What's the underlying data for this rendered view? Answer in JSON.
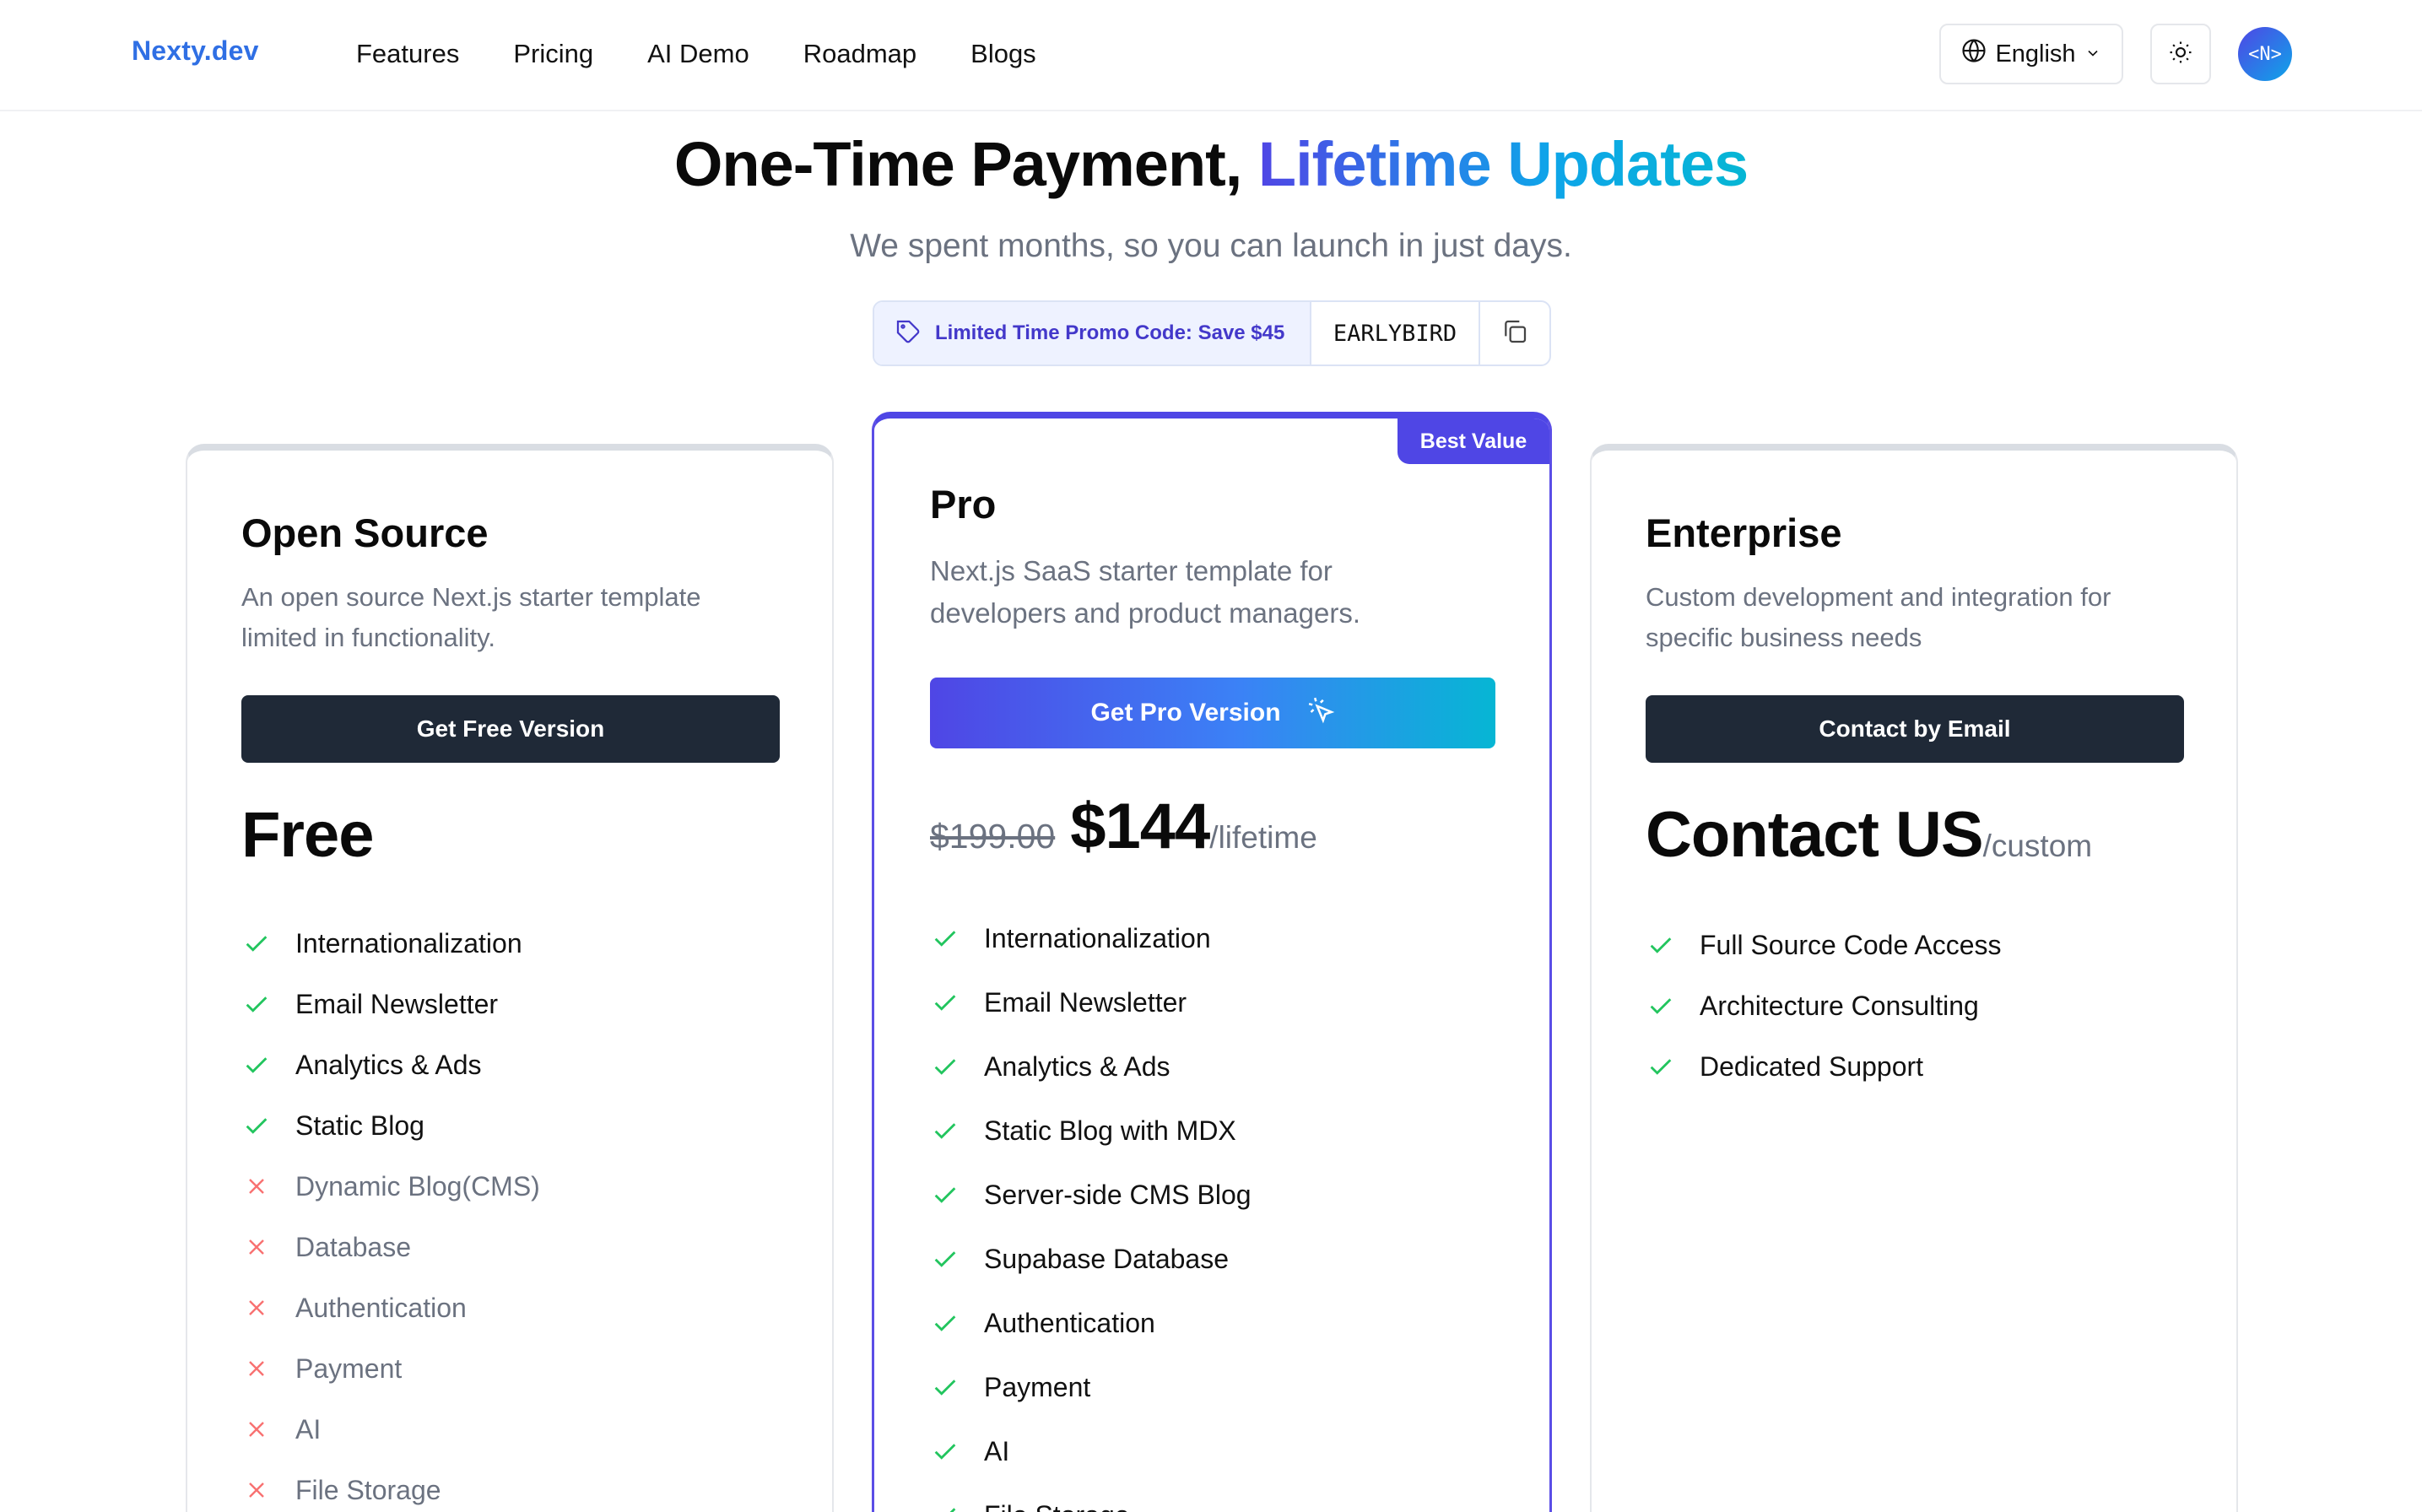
{
  "header": {
    "brand": "Nexty.dev",
    "nav": [
      "Features",
      "Pricing",
      "AI Demo",
      "Roadmap",
      "Blogs"
    ],
    "language": "English",
    "avatar_text": "<N>"
  },
  "hero": {
    "title_plain": "One-Time Payment,",
    "title_gradient": "Lifetime Updates",
    "subtitle": "We spent months, so you can launch in just days.",
    "promo_label": "Limited Time Promo Code: Save $45",
    "promo_code": "EARLYBIRD"
  },
  "plans": {
    "free": {
      "title": "Open Source",
      "desc_line1": "An open source Next.js starter template",
      "desc_line2": "limited in functionality.",
      "button": "Get Free Version",
      "price": "Free",
      "features": [
        {
          "label": "Internationalization",
          "included": true
        },
        {
          "label": "Email Newsletter",
          "included": true
        },
        {
          "label": "Analytics & Ads",
          "included": true
        },
        {
          "label": "Static Blog",
          "included": true
        },
        {
          "label": "Dynamic Blog(CMS)",
          "included": false
        },
        {
          "label": "Database",
          "included": false
        },
        {
          "label": "Authentication",
          "included": false
        },
        {
          "label": "Payment",
          "included": false
        },
        {
          "label": "AI",
          "included": false
        },
        {
          "label": "File Storage",
          "included": false
        }
      ]
    },
    "pro": {
      "badge": "Best Value",
      "title": "Pro",
      "desc_line1": "Next.js SaaS starter template for",
      "desc_line2": "developers and product managers.",
      "button": "Get Pro Version",
      "old_price": "$199.00",
      "price": "$144",
      "unit": "/lifetime",
      "features": [
        {
          "label": "Internationalization",
          "included": true
        },
        {
          "label": "Email Newsletter",
          "included": true
        },
        {
          "label": "Analytics & Ads",
          "included": true
        },
        {
          "label": "Static Blog with MDX",
          "included": true
        },
        {
          "label": "Server-side CMS Blog",
          "included": true
        },
        {
          "label": "Supabase Database",
          "included": true
        },
        {
          "label": "Authentication",
          "included": true
        },
        {
          "label": "Payment",
          "included": true
        },
        {
          "label": "AI",
          "included": true
        },
        {
          "label": "File Storage",
          "included": true
        }
      ]
    },
    "enterprise": {
      "title": "Enterprise",
      "desc_line1": "Custom development and integration for",
      "desc_line2": "specific business needs",
      "button": "Contact by Email",
      "price": "Contact US",
      "unit": "/custom",
      "features": [
        {
          "label": "Full Source Code Access",
          "included": true
        },
        {
          "label": "Architecture Consulting",
          "included": true
        },
        {
          "label": "Dedicated Support",
          "included": true
        }
      ]
    }
  },
  "colors": {
    "brand": "#2f6fe4",
    "accent": "#4f46e5",
    "check": "#22c55e",
    "cross": "#f87171",
    "dark_button": "#1f2937"
  }
}
